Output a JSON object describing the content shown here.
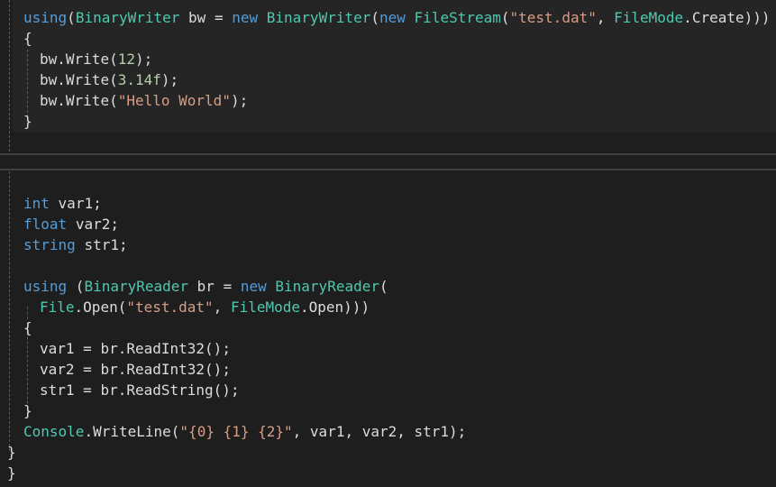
{
  "editor_top": {
    "lines": [
      "using(BinaryWriter bw = new BinaryWriter(new FileStream(\"test.dat\", FileMode.Create)))",
      "{",
      "bw.Write(12);",
      "bw.Write(3.14f);",
      "bw.Write(\"Hello World\");",
      "}"
    ]
  },
  "editor_bottom": {
    "lines": [
      "int var1;",
      "float var2;",
      "string str1;",
      "",
      "using (BinaryReader br = new BinaryReader(",
      "File.Open(\"test.dat\", FileMode.Open)))",
      "{",
      "var1 = br.ReadInt32();",
      "var2 = br.ReadInt32();",
      "str1 = br.ReadString();",
      "}",
      "Console.WriteLine(\"{0} {1} {2}\", var1, var2, str1);",
      "}",
      "}"
    ]
  },
  "colors": {
    "background": "#1e1e1e",
    "keyword": "#569cd6",
    "type": "#4ec9b0",
    "string": "#d69d85",
    "number": "#b5cea8",
    "plain": "#dcdcdc"
  }
}
